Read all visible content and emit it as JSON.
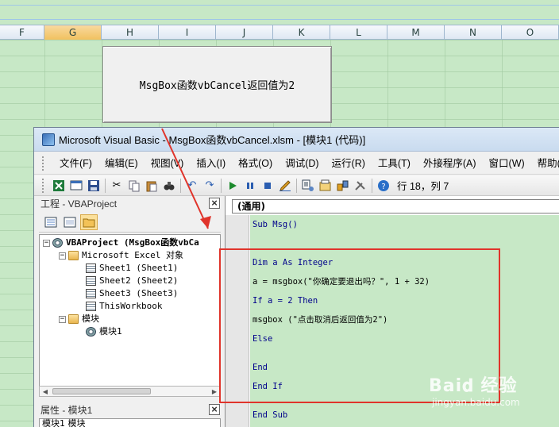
{
  "sheet": {
    "columns": [
      "F",
      "G",
      "H",
      "I",
      "J",
      "K",
      "L",
      "M",
      "N",
      "O"
    ],
    "active_column": "G",
    "button_label": "MsgBox函数vbCancel返回值为2"
  },
  "vbe": {
    "title": "Microsoft Visual Basic - MsgBox函数vbCancel.xlsm - [模块1 (代码)]",
    "menu": [
      "文件(F)",
      "编辑(E)",
      "视图(V)",
      "插入(I)",
      "格式(O)",
      "调试(D)",
      "运行(R)",
      "工具(T)",
      "外接程序(A)",
      "窗口(W)",
      "帮助(H)"
    ],
    "toolbar_status": "行 18，列 7",
    "project_panel_title": "工程 - VBAProject",
    "tree": {
      "project": "VBAProject (MsgBox函数vbCa",
      "excel_objects": "Microsoft Excel 对象",
      "sheets": [
        "Sheet1 (Sheet1)",
        "Sheet2 (Sheet2)",
        "Sheet3 (Sheet3)"
      ],
      "workbook": "ThisWorkbook",
      "modules_folder": "模块",
      "module": "模块1"
    },
    "properties_title": "属性 - 模块1",
    "properties_value": "模块1 模块"
  },
  "code": {
    "proc_combo": "(通用)",
    "lines": {
      "l1": "Sub Msg()",
      "l2": "Dim a As Integer",
      "l3": "a = msgbox(\"你确定要退出吗？\", 1 + 32)",
      "l4": "If a = 2 Then",
      "l5": "msgbox (\"点击取消后返回值为2\")",
      "l6": "Else",
      "l7": "End",
      "l8": "End If",
      "l9": "End Sub"
    }
  },
  "watermark": {
    "brand": "Bai𝐝 经验",
    "url": "jingyan.baidu.com"
  },
  "colors": {
    "sheet_bg": "#c7e8c6",
    "highlight": "#e0342b",
    "keyword": "#00008b"
  }
}
